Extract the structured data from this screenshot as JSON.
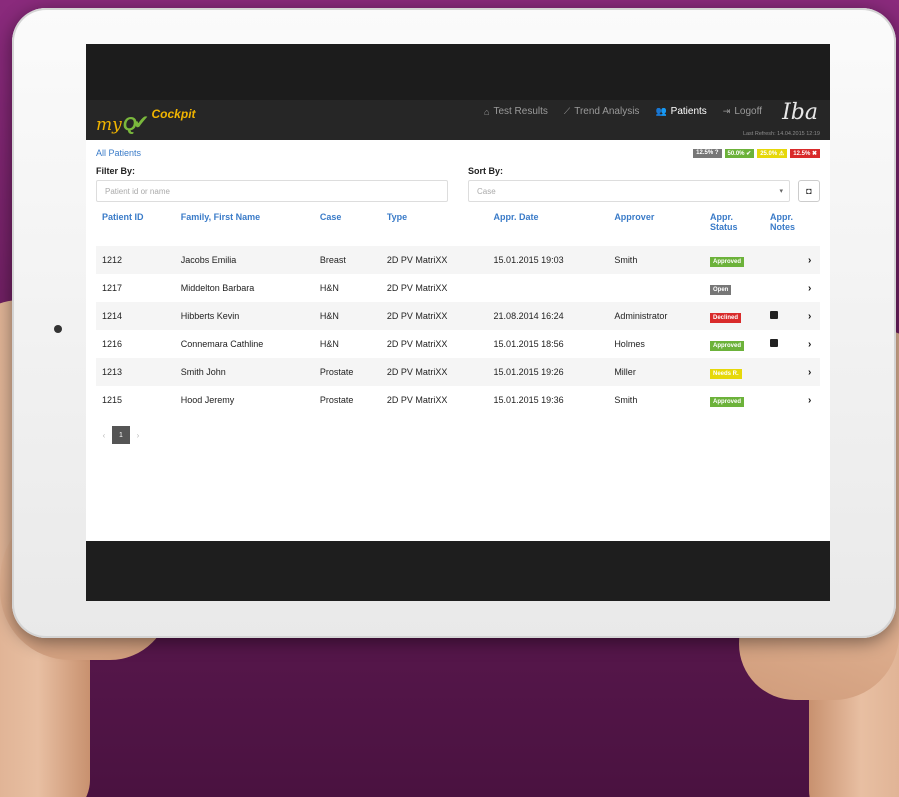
{
  "app": {
    "logo_my": "my",
    "logo_qa": "Q",
    "logo_cockpit": "Cockpit",
    "brand_right": "Iba",
    "last_refresh": "Last Refresh: 14.04.2015 12:19"
  },
  "nav": [
    {
      "label": "Test Results",
      "icon": "home-icon",
      "active": false
    },
    {
      "label": "Trend Analysis",
      "icon": "chart-icon",
      "active": false
    },
    {
      "label": "Patients",
      "icon": "users-icon",
      "active": true
    },
    {
      "label": "Logoff",
      "icon": "signout-icon",
      "active": false
    }
  ],
  "breadcrumb": "All Patients",
  "summary_badges": [
    {
      "label": "12.5% ?",
      "color": "#777777"
    },
    {
      "label": "50.0% ✔",
      "color": "#6cb23a"
    },
    {
      "label": "25.0% ⚠",
      "color": "#e6d80a"
    },
    {
      "label": "12.5% ✖",
      "color": "#d92b2b"
    }
  ],
  "filter": {
    "label": "Filter By:",
    "placeholder": "Patient id or name"
  },
  "sort": {
    "label": "Sort By:",
    "placeholder": "Case"
  },
  "table": {
    "headers": [
      "Patient ID",
      "Family, First Name",
      "Case",
      "Type",
      "Appr. Date",
      "Approver",
      "Appr. Status",
      "Appr. Notes"
    ],
    "rows": [
      {
        "id": "1212",
        "name": "Jacobs Emilia",
        "case": "Breast",
        "type": "2D PV MatriXX",
        "date": "15.01.2015 19:03",
        "approver": "Smith",
        "status": "Approved",
        "note": false
      },
      {
        "id": "1217",
        "name": "Middelton Barbara",
        "case": "H&N",
        "type": "2D PV MatriXX",
        "date": "",
        "approver": "",
        "status": "Open",
        "note": false
      },
      {
        "id": "1214",
        "name": "Hibberts Kevin",
        "case": "H&N",
        "type": "2D PV MatriXX",
        "date": "21.08.2014 16:24",
        "approver": "Administrator",
        "status": "Declined",
        "note": true
      },
      {
        "id": "1216",
        "name": "Connemara Cathline",
        "case": "H&N",
        "type": "2D PV MatriXX",
        "date": "15.01.2015 18:56",
        "approver": "Holmes",
        "status": "Approved",
        "note": true
      },
      {
        "id": "1213",
        "name": "Smith John",
        "case": "Prostate",
        "type": "2D PV MatriXX",
        "date": "15.01.2015 19:26",
        "approver": "Miller",
        "status": "Needs R.",
        "note": false
      },
      {
        "id": "1215",
        "name": "Hood Jeremy",
        "case": "Prostate",
        "type": "2D PV MatriXX",
        "date": "15.01.2015 19:36",
        "approver": "Smith",
        "status": "Approved",
        "note": false
      }
    ]
  },
  "pagination": {
    "prev": "‹",
    "current": "1",
    "next": "›"
  }
}
